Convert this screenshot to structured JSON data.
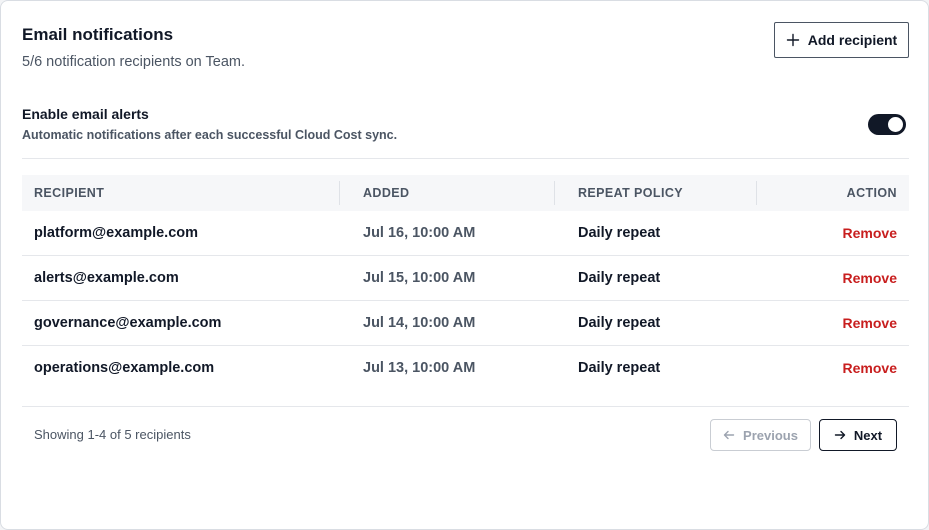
{
  "header": {
    "title": "Email notifications",
    "subtitle": "5/6 notification recipients on Team.",
    "add_button_label": "Add recipient",
    "add_icon": "plus-icon"
  },
  "alerts": {
    "title": "Enable email alerts",
    "description": "Automatic notifications after each successful Cloud Cost sync.",
    "enabled": true
  },
  "table": {
    "columns": [
      "RECIPIENT",
      "ADDED",
      "REPEAT POLICY",
      "ACTION"
    ],
    "rows": [
      {
        "email": "platform@example.com",
        "added": "Jul 16, 10:00 AM",
        "policy": "Daily repeat",
        "action": "Remove"
      },
      {
        "email": "alerts@example.com",
        "added": "Jul 15, 10:00 AM",
        "policy": "Daily repeat",
        "action": "Remove"
      },
      {
        "email": "governance@example.com",
        "added": "Jul 14, 10:00 AM",
        "policy": "Daily repeat",
        "action": "Remove"
      },
      {
        "email": "operations@example.com",
        "added": "Jul 13, 10:00 AM",
        "policy": "Daily repeat",
        "action": "Remove"
      }
    ]
  },
  "pagination": {
    "showing": "Showing 1-4 of 5 recipients",
    "previous_label": "Previous",
    "next_label": "Next",
    "previous_icon": "arrow-left-icon",
    "next_icon": "arrow-right-icon"
  },
  "colors": {
    "accent": "#111827",
    "danger": "#c81e1e",
    "muted": "#4b5563"
  }
}
